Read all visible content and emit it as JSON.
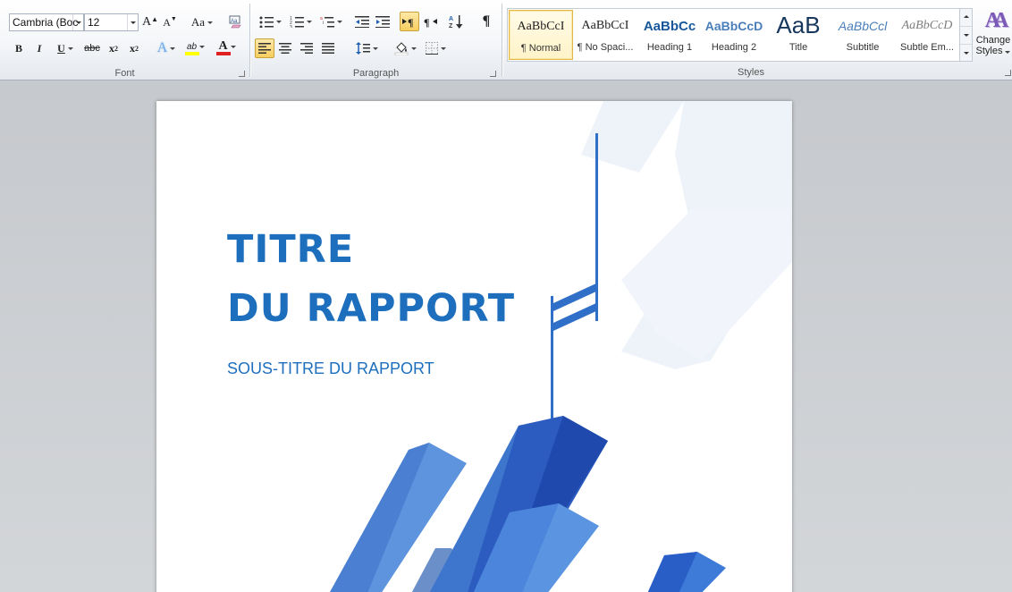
{
  "ribbon": {
    "font": {
      "label": "Font",
      "family": "Cambria (Boc",
      "size": "12",
      "grow": "A",
      "shrink": "A",
      "change_case": "Aa",
      "bold": "B",
      "italic": "I",
      "underline": "U",
      "strike": "abc",
      "subscript": "x",
      "subscript_mark": "2",
      "superscript": "x",
      "superscript_mark": "2",
      "highlight": "ab",
      "color": "A",
      "effects": "A",
      "highlight_color": "#ffff00",
      "font_color": "#e02020"
    },
    "paragraph": {
      "label": "Paragraph",
      "pilcrow": "¶"
    },
    "styles": {
      "label": "Styles",
      "items": [
        {
          "preview": "AaBbCcI",
          "name": "¶ Normal"
        },
        {
          "preview": "AaBbCcI",
          "name": "¶ No Spaci..."
        },
        {
          "preview": "AaBbCc",
          "name": "Heading 1"
        },
        {
          "preview": "AaBbCcD",
          "name": "Heading 2"
        },
        {
          "preview": "AaB",
          "name": "Title"
        },
        {
          "preview": "AaBbCcl",
          "name": "Subtitle"
        },
        {
          "preview": "AaBbCcD",
          "name": "Subtle Em..."
        }
      ],
      "change_styles_icon": "AA",
      "change_styles_line1": "Change",
      "change_styles_line2": "Styles"
    }
  },
  "document": {
    "title_line1": "TITRE",
    "title_line2": "DU RAPPORT",
    "subtitle": "SOUS-TITRE DU RAPPORT",
    "accent_color": "#1d6fbe"
  }
}
